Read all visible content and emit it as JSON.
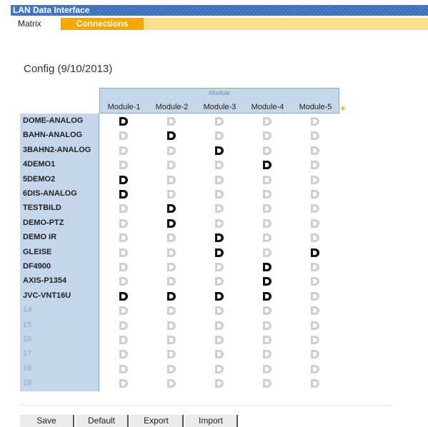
{
  "app": {
    "title": "LAN Data Interface"
  },
  "tabs": [
    {
      "label": "Matrix",
      "active": false
    },
    {
      "label": "Connections",
      "active": true
    }
  ],
  "config_title": "Config (9/10/2013)",
  "matrix": {
    "group_label": "Module",
    "columns": [
      "Module-1",
      "Module-2",
      "Module-3",
      "Module-4",
      "Module-5"
    ],
    "add_column_symbol": "+",
    "rows": [
      {
        "name": "DOME-ANALOG",
        "active": [
          1,
          0,
          0,
          0,
          0
        ]
      },
      {
        "name": "BAHN-ANALOG",
        "active": [
          0,
          1,
          0,
          0,
          0
        ]
      },
      {
        "name": "3BAHN2-ANALOG",
        "active": [
          0,
          0,
          1,
          0,
          0
        ]
      },
      {
        "name": "4DEMO1",
        "active": [
          0,
          0,
          0,
          1,
          0
        ]
      },
      {
        "name": "5DEMO2",
        "active": [
          1,
          0,
          0,
          0,
          0
        ]
      },
      {
        "name": "6DIS-ANALOG",
        "active": [
          1,
          0,
          0,
          0,
          0
        ]
      },
      {
        "name": "TESTBILD",
        "active": [
          0,
          1,
          0,
          0,
          0
        ]
      },
      {
        "name": "DEMO-PTZ",
        "active": [
          0,
          1,
          0,
          0,
          0
        ]
      },
      {
        "name": "DEMO IR",
        "active": [
          0,
          0,
          1,
          0,
          0
        ]
      },
      {
        "name": "GLEISE",
        "active": [
          0,
          0,
          1,
          0,
          1
        ]
      },
      {
        "name": "DF4900",
        "active": [
          0,
          0,
          0,
          1,
          0
        ]
      },
      {
        "name": "AXIS-P1354",
        "active": [
          0,
          0,
          0,
          1,
          0
        ]
      },
      {
        "name": "JVC-VNT16U",
        "active": [
          1,
          1,
          1,
          1,
          0
        ]
      },
      {
        "name": "14",
        "empty": true,
        "active": [
          0,
          0,
          0,
          0,
          0
        ]
      },
      {
        "name": "15",
        "empty": true,
        "active": [
          0,
          0,
          0,
          0,
          0
        ]
      },
      {
        "name": "16",
        "empty": true,
        "active": [
          0,
          0,
          0,
          0,
          0
        ]
      },
      {
        "name": "17",
        "empty": true,
        "active": [
          0,
          0,
          0,
          0,
          0
        ]
      },
      {
        "name": "18",
        "empty": true,
        "active": [
          0,
          0,
          0,
          0,
          0
        ]
      },
      {
        "name": "19",
        "empty": true,
        "active": [
          0,
          0,
          0,
          0,
          0
        ]
      }
    ],
    "icon": "connection-d-icon",
    "colors": {
      "active": "#111111",
      "inactive": "#cfcfcf",
      "header_bg": "#c6d7ea",
      "accent": "#f5a800"
    }
  },
  "buttons": [
    {
      "label": "Save"
    },
    {
      "label": "Default"
    },
    {
      "label": "Export"
    },
    {
      "label": "Import"
    }
  ]
}
